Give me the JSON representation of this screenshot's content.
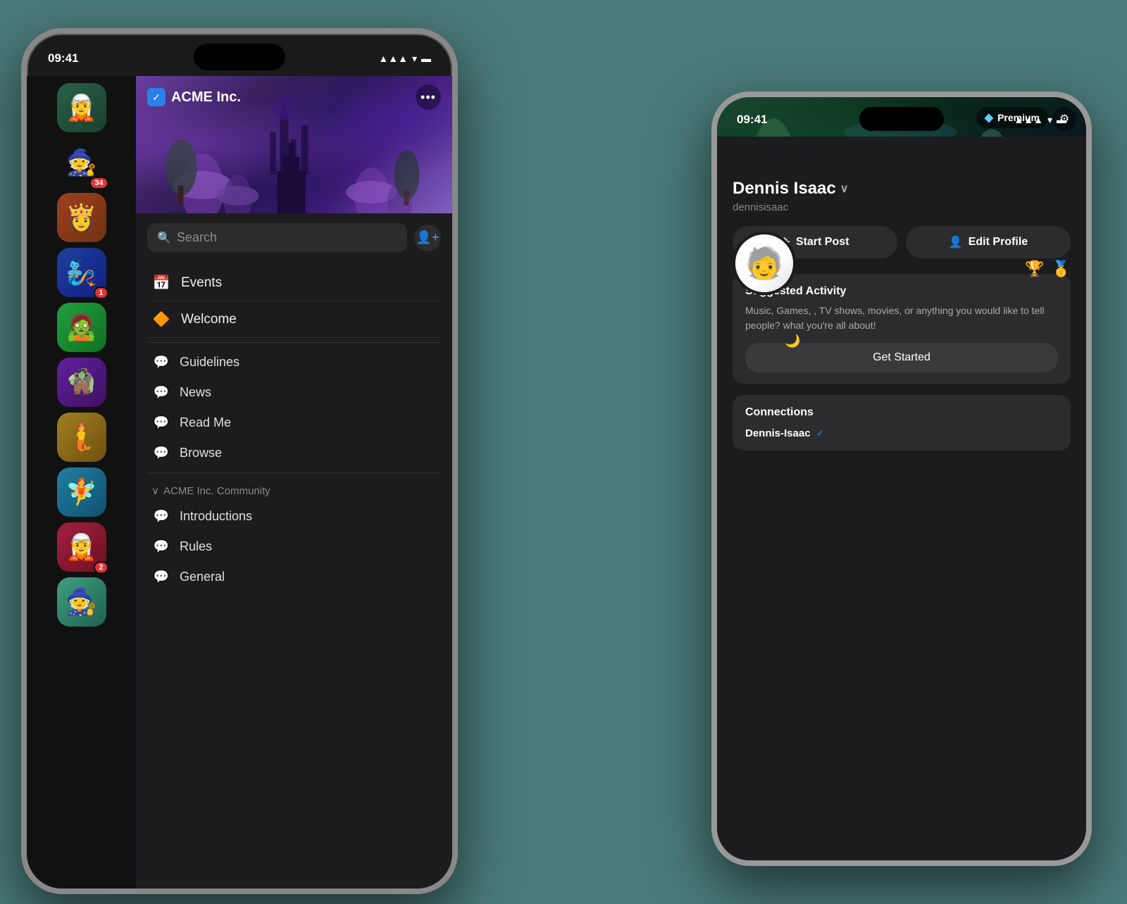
{
  "background": "#4a7a7a",
  "phone_left": {
    "status_bar": {
      "time": "09:41",
      "signal": "▪▪▪",
      "wifi": "wifi",
      "battery": "battery"
    },
    "banner": {
      "title": "ACME Inc.",
      "more_icon": "•••"
    },
    "search": {
      "placeholder": "Search"
    },
    "nav_items": [
      {
        "icon": "📅",
        "label": "Events"
      },
      {
        "icon": "🔶",
        "label": "Welcome"
      }
    ],
    "channels": [
      {
        "icon": "💬",
        "label": "Guidelines"
      },
      {
        "icon": "💬",
        "label": "News"
      },
      {
        "icon": "💬",
        "label": "Read Me"
      },
      {
        "icon": "💬",
        "label": "Browse"
      }
    ],
    "community_section": {
      "title": "ACME Inc. Community",
      "channels": [
        {
          "icon": "💬",
          "label": "Introductions"
        },
        {
          "icon": "💬",
          "label": "Rules"
        },
        {
          "icon": "💬",
          "label": "General"
        }
      ]
    },
    "avatars": [
      {
        "emoji": "🧝",
        "bg": "av1",
        "badge": null
      },
      {
        "emoji": "🧙",
        "bg": "av2",
        "badge": "34"
      },
      {
        "emoji": "👸",
        "bg": "av3",
        "badge": null
      },
      {
        "emoji": "🧞",
        "bg": "av4",
        "badge": "1"
      },
      {
        "emoji": "🧟",
        "bg": "av5",
        "badge": null
      },
      {
        "emoji": "🧌",
        "bg": "av6",
        "badge": null
      },
      {
        "emoji": "🧜",
        "bg": "av7",
        "badge": null
      },
      {
        "emoji": "🧚",
        "bg": "av8",
        "badge": null
      },
      {
        "emoji": "🧝",
        "bg": "av9",
        "badge": "2"
      },
      {
        "emoji": "🧙",
        "bg": "av10",
        "badge": null
      }
    ]
  },
  "phone_right": {
    "status_bar": {
      "time": "09:41",
      "signal": "▪▪▪",
      "wifi": "wifi",
      "battery": "battery"
    },
    "premium_label": "Premium",
    "settings_icon": "⚙",
    "profile": {
      "name": "Dennis Isaac",
      "username": "dennisisaac",
      "avatar_emoji": "🧓",
      "moon_emoji": "🌙",
      "trophy_emoji": "🏆",
      "medal_emoji": "🥇",
      "start_post_label": "Start Post",
      "edit_profile_label": "Edit Profile"
    },
    "suggested_activity": {
      "title": "Suggested Activity",
      "description": "Music, Games, , TV shows, movies, or anything you would like to tell people? what you're all about!",
      "button_label": "Get Started"
    },
    "connections": {
      "title": "Connections",
      "items": [
        {
          "name": "Dennis-Isaac",
          "verified": true
        }
      ]
    }
  }
}
